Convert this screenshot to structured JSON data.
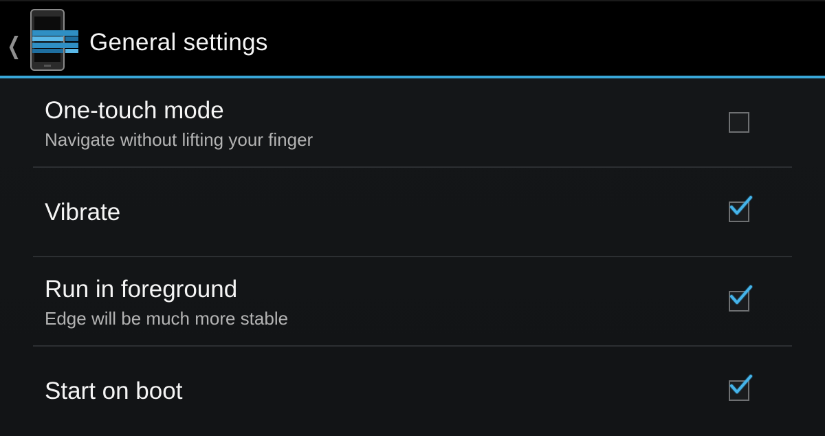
{
  "actionbar": {
    "title": "General settings",
    "up_icon": "chevron-left-icon",
    "app_icon": "edge-app-icon"
  },
  "accent_color": "#39a7d8",
  "settings": [
    {
      "title": "One-touch mode",
      "summary": "Navigate without lifting your finger",
      "checked": false
    },
    {
      "title": "Vibrate",
      "summary": "",
      "checked": true
    },
    {
      "title": "Run in foreground",
      "summary": "Edge will be much more stable",
      "checked": true
    },
    {
      "title": "Start on boot",
      "summary": "",
      "checked": true
    }
  ]
}
